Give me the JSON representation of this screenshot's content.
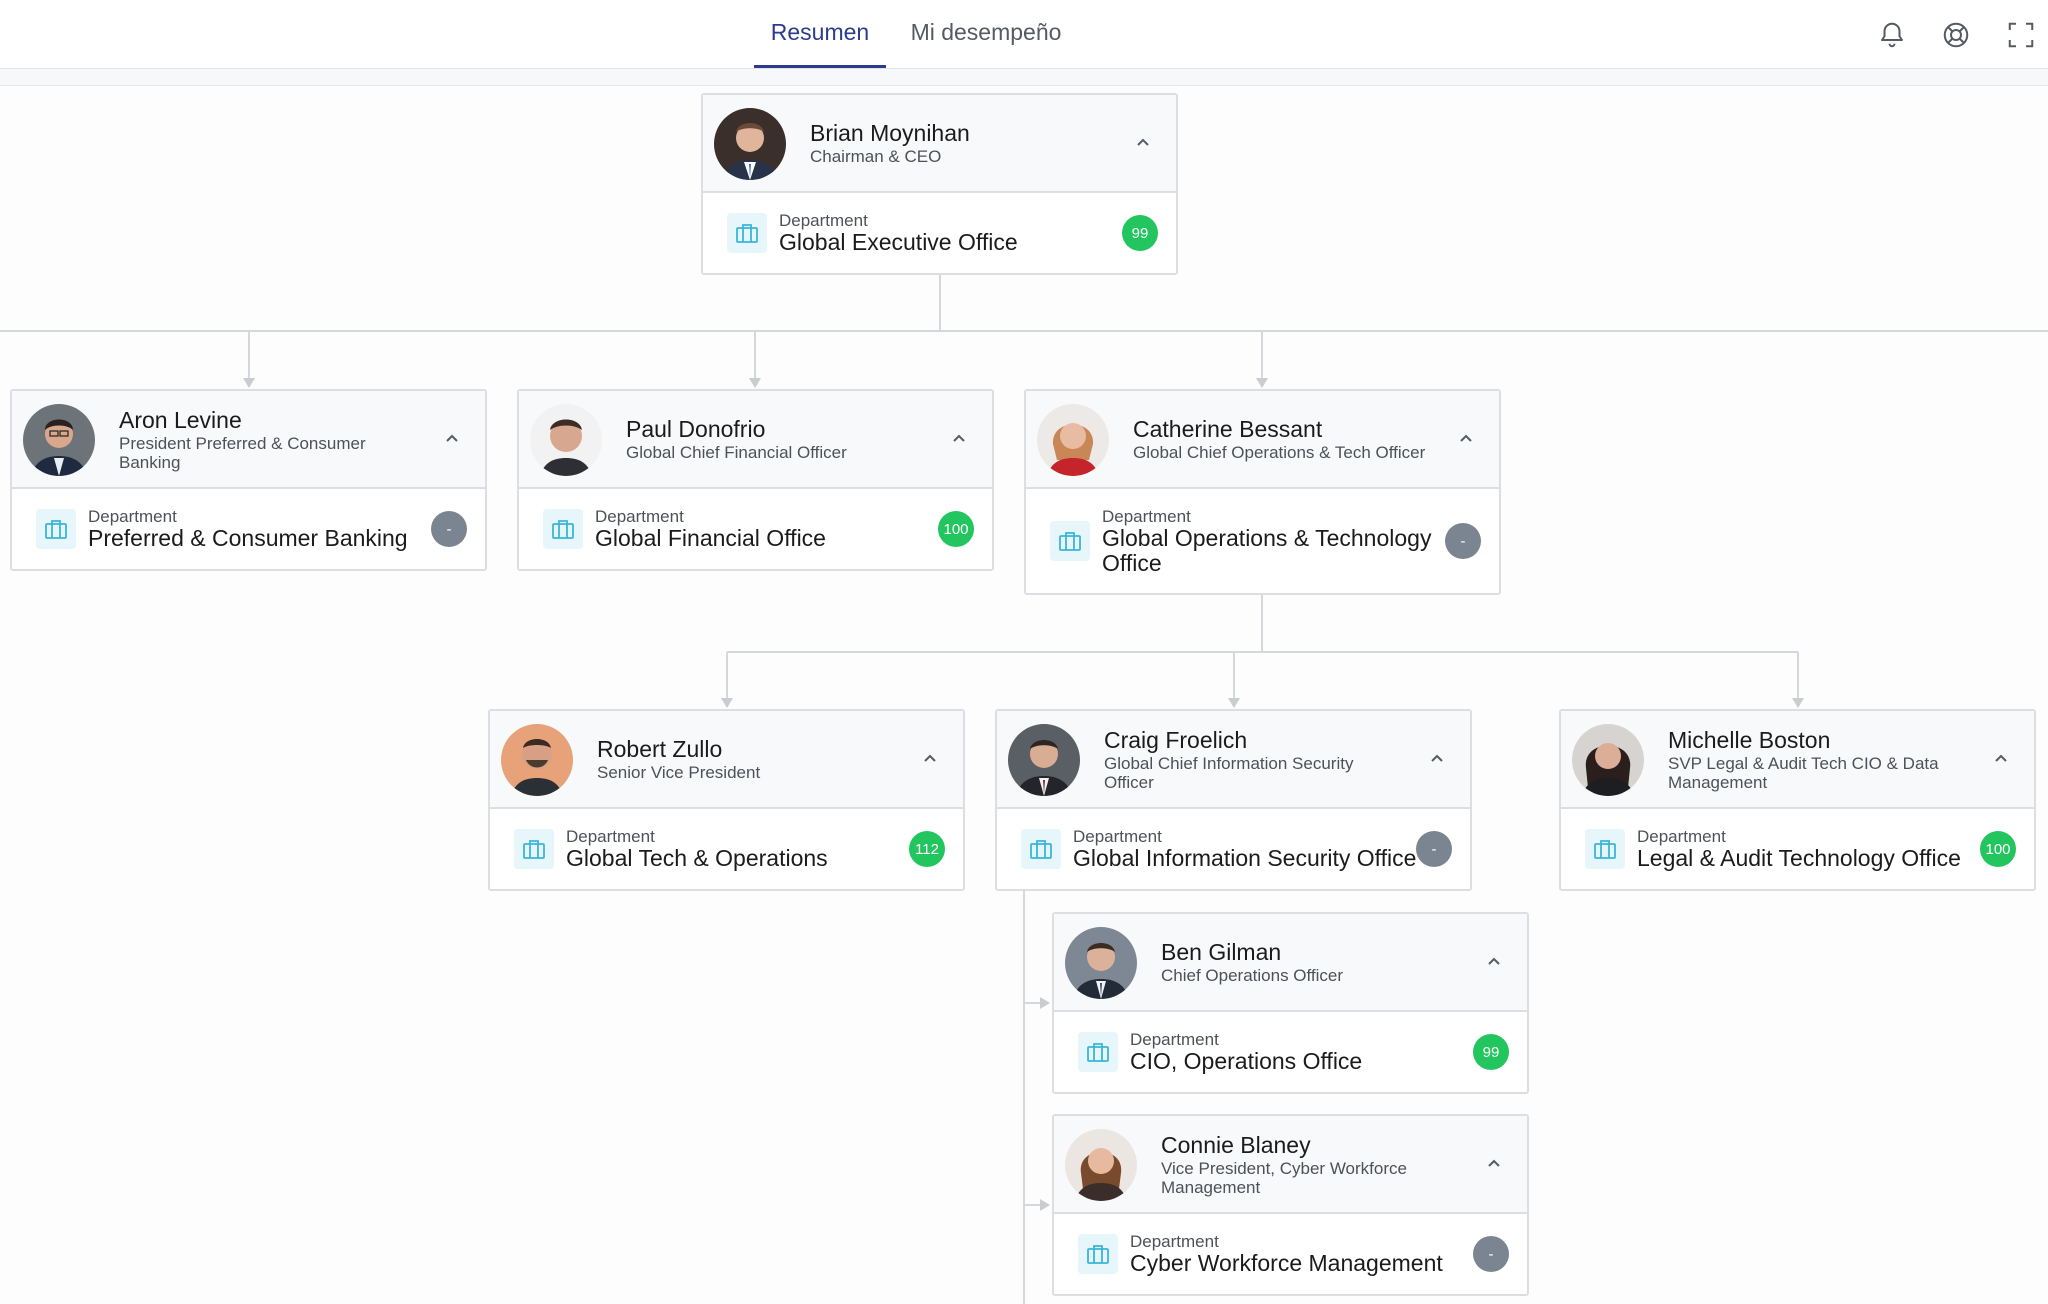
{
  "tabs": [
    {
      "label": "Resumen",
      "active": true
    },
    {
      "label": "Mi desempeño",
      "active": false
    }
  ],
  "header_icons": [
    "bell-icon",
    "help-icon",
    "fullscreen-icon"
  ],
  "colors": {
    "accent": "#2b3b8f",
    "badge_green": "#22c55e",
    "badge_gray": "#7b8592",
    "dept_icon": "#3ab6d8"
  },
  "dept_label": "Department",
  "people": {
    "brian": {
      "name": "Brian Moynihan",
      "title": "Chairman & CEO",
      "dept": "Global Executive Office",
      "badge": "99",
      "badge_color": "green"
    },
    "aron": {
      "name": "Aron Levine",
      "title": "President Preferred & Consumer Banking",
      "dept": "Preferred & Consumer Banking",
      "badge": "-",
      "badge_color": "gray"
    },
    "paul": {
      "name": "Paul Donofrio",
      "title": "Global Chief Financial Officer",
      "dept": "Global Financial Office",
      "badge": "100",
      "badge_color": "green"
    },
    "catherine": {
      "name": "Catherine Bessant",
      "title": "Global Chief Operations & Tech Officer",
      "dept": "Global Operations & Technology Office",
      "badge": "-",
      "badge_color": "gray"
    },
    "robert": {
      "name": "Robert Zullo",
      "title": "Senior Vice President",
      "dept": "Global Tech & Operations",
      "badge": "112",
      "badge_color": "green"
    },
    "craig": {
      "name": "Craig Froelich",
      "title": "Global Chief Information Security Officer",
      "dept": "Global Information Security Office",
      "badge": "-",
      "badge_color": "gray"
    },
    "michelle": {
      "name": "Michelle Boston",
      "title": "SVP Legal & Audit Tech CIO & Data Management",
      "dept": "Legal & Audit Technology Office",
      "badge": "100",
      "badge_color": "green"
    },
    "ben": {
      "name": "Ben Gilman",
      "title": "Chief Operations Officer",
      "dept": "CIO, Operations Office",
      "badge": "99",
      "badge_color": "green"
    },
    "connie": {
      "name": "Connie Blaney",
      "title": "Vice President, Cyber Workforce Management",
      "dept": "Cyber Workforce Management",
      "badge": "-",
      "badge_color": "gray"
    }
  }
}
